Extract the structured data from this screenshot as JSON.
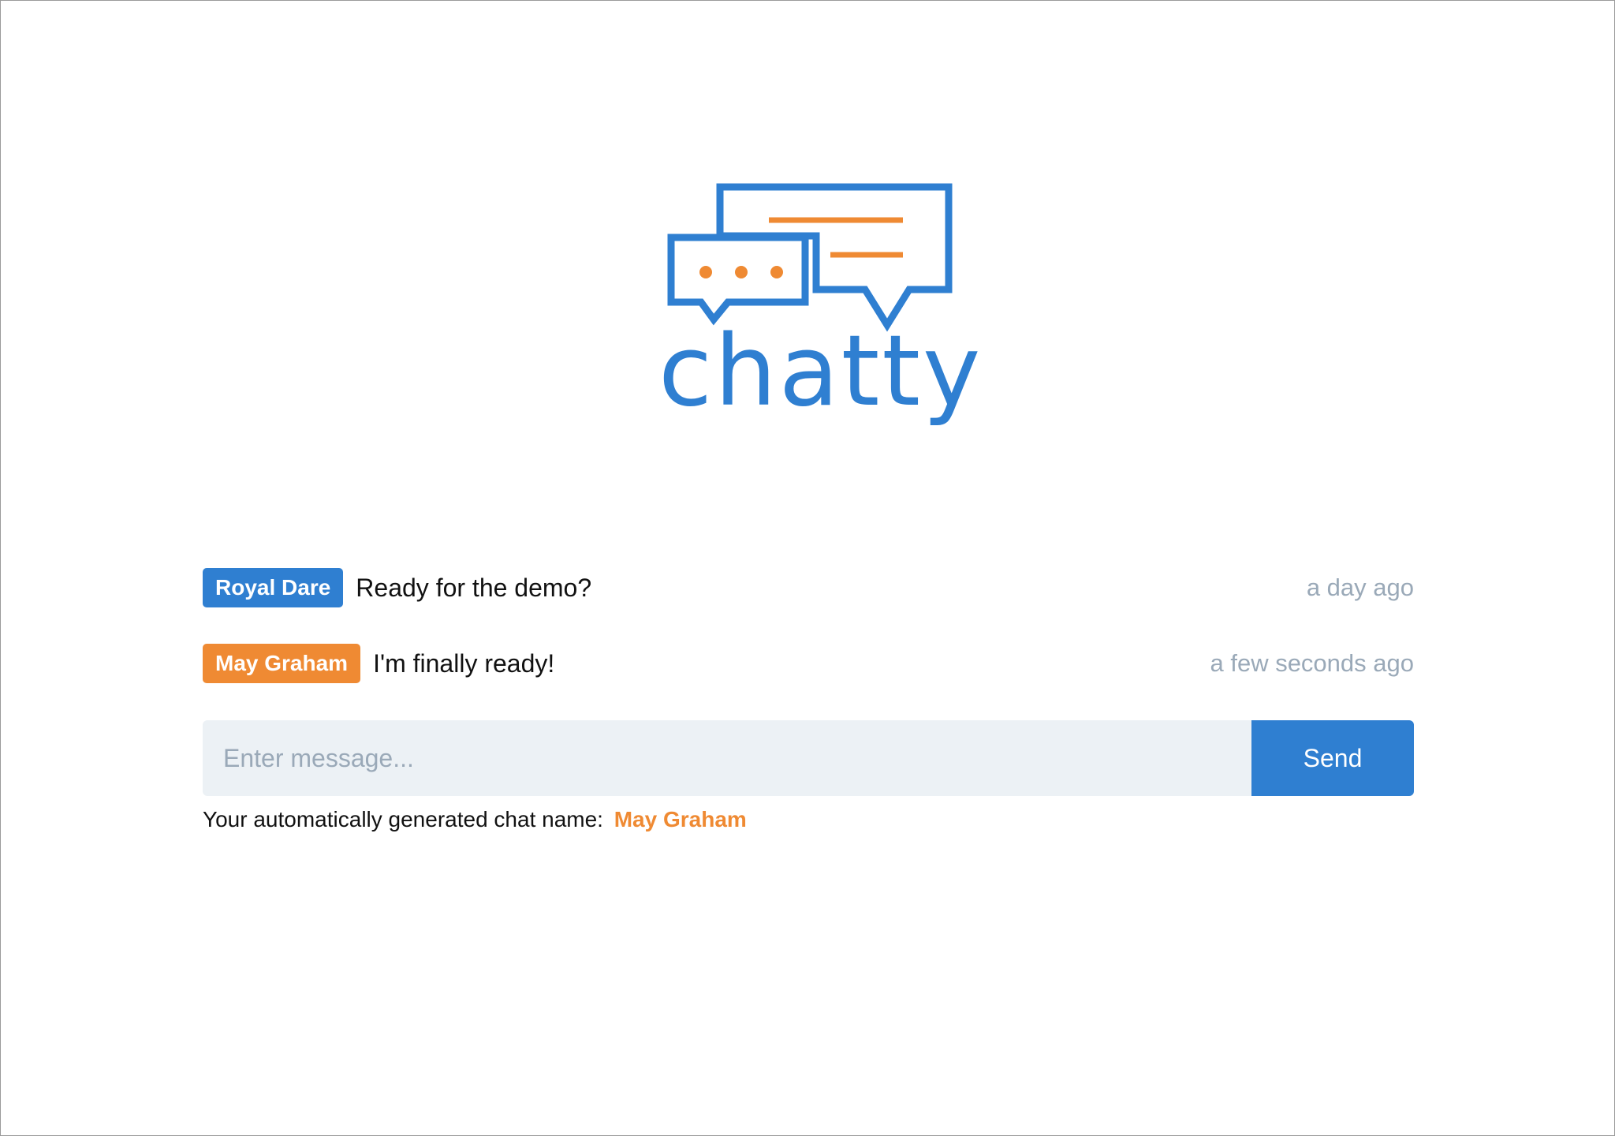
{
  "brand": {
    "name": "chatty",
    "colors": {
      "primary": "#2f7fd1",
      "accent": "#ef8a33"
    }
  },
  "messages": [
    {
      "author": "Royal Dare",
      "color": "blue",
      "text": "Ready for the demo?",
      "time": "a day ago"
    },
    {
      "author": "May Graham",
      "color": "orange",
      "text": "I'm finally ready!",
      "time": "a few seconds ago"
    }
  ],
  "composer": {
    "placeholder": "Enter message...",
    "value": "",
    "send_label": "Send"
  },
  "footer": {
    "prefix": "Your automatically generated chat name:",
    "name": "May Graham"
  }
}
